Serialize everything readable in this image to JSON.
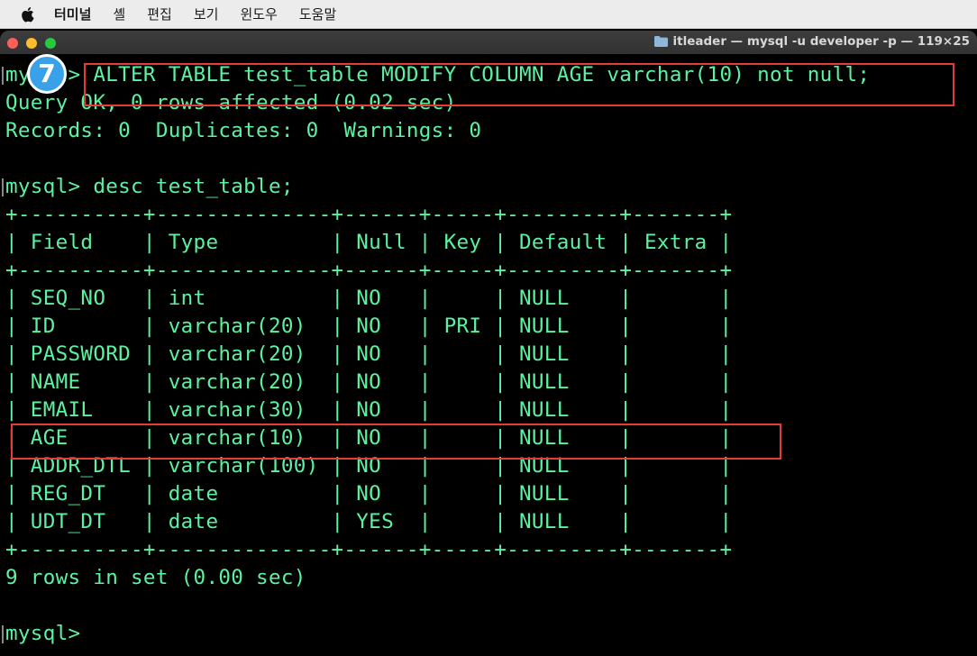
{
  "menubar": {
    "items": [
      "터미널",
      "셸",
      "편집",
      "보기",
      "윈도우",
      "도움말"
    ]
  },
  "window": {
    "title": "itleader — mysql -u developer -p — 119×25"
  },
  "annotation": {
    "step_number": "7"
  },
  "terminal": {
    "lines": [
      "mysql> ALTER TABLE test_table MODIFY COLUMN AGE varchar(10) not null;",
      "Query OK, 0 rows affected (0.02 sec)",
      "Records: 0  Duplicates: 0  Warnings: 0",
      "",
      "mysql> desc test_table;",
      "+----------+--------------+------+-----+---------+-------+",
      "| Field    | Type         | Null | Key | Default | Extra |",
      "+----------+--------------+------+-----+---------+-------+",
      "| SEQ_NO   | int          | NO   |     | NULL    |       |",
      "| ID       | varchar(20)  | NO   | PRI | NULL    |       |",
      "| PASSWORD | varchar(20)  | NO   |     | NULL    |       |",
      "| NAME     | varchar(20)  | NO   |     | NULL    |       |",
      "| EMAIL    | varchar(30)  | NO   |     | NULL    |       |",
      "| AGE      | varchar(10)  | NO   |     | NULL    |       |",
      "| ADDR_DTL | varchar(100) | NO   |     | NULL    |       |",
      "| REG_DT   | date         | NO   |     | NULL    |       |",
      "| UDT_DT   | date         | YES  |     | NULL    |       |",
      "+----------+--------------+------+-----+---------+-------+",
      "9 rows in set (0.00 sec)",
      "",
      "mysql>"
    ]
  },
  "colors": {
    "terminal_text": "#5bf2a0",
    "terminal_bg": "#000000",
    "highlight_box": "#e43b3b",
    "badge": "#3aa0e8"
  }
}
